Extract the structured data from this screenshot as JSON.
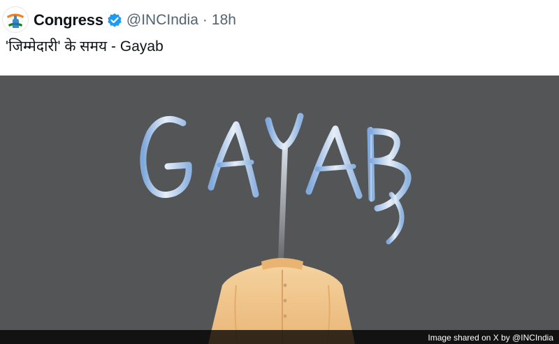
{
  "post": {
    "author": "Congress",
    "handle": "@INCIndia",
    "separator": "·",
    "time": "18h",
    "text": "'जिम्मेदारी' के समय - Gayab"
  },
  "media": {
    "artwork_word": "GAYAB",
    "background_color": "#545557",
    "lettering_colors": [
      "#a9c6ea",
      "#dbe7f6",
      "#8fb2de"
    ],
    "shirt_color": "#f2c98f"
  },
  "caption": {
    "text": "Image shared on X by @INCIndia"
  },
  "icons": {
    "avatar": "congress-hand-logo",
    "verified": "verified-badge-icon"
  },
  "colors": {
    "name": "#0f1419",
    "secondary": "#536471",
    "verified": "#1d9bf0"
  }
}
